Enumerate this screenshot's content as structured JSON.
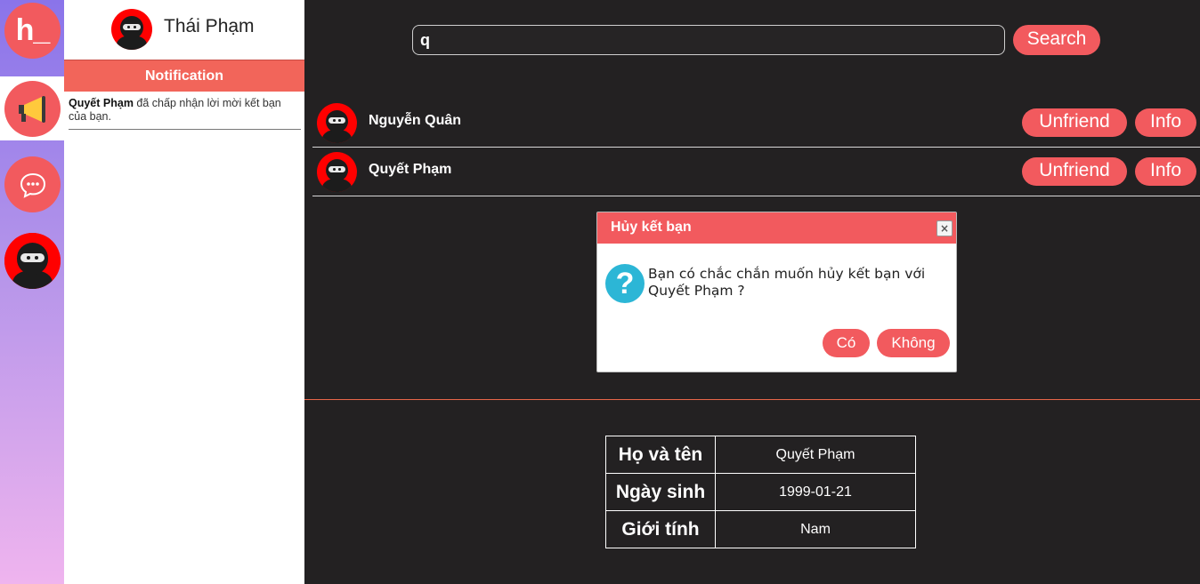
{
  "app": {
    "logo_text": "h_",
    "user_name": "Thái Phạm"
  },
  "rail": {
    "items": [
      {
        "icon": "logo-icon"
      },
      {
        "icon": "megaphone-icon"
      },
      {
        "icon": "chat-icon"
      },
      {
        "icon": "ninja-avatar-icon"
      }
    ]
  },
  "notification": {
    "title": "Notification",
    "items": [
      {
        "sender": "Quyết Phạm",
        "message": "đã chấp nhận lời mời kết bạn của bạn."
      }
    ]
  },
  "search": {
    "value": "q",
    "button_label": "Search"
  },
  "friends": [
    {
      "name": "Nguyễn Quân",
      "unfriend_label": "Unfriend",
      "info_label": "Info"
    },
    {
      "name": "Quyết Phạm",
      "unfriend_label": "Unfriend",
      "info_label": "Info"
    }
  ],
  "dialog": {
    "title": "Hủy kết bạn",
    "close_glyph": "×",
    "icon_glyph": "?",
    "message": "Bạn có chắc chắn muốn hủy kết bạn với Quyết Phạm ?",
    "yes_label": "Có",
    "no_label": "Không"
  },
  "profile": {
    "rows": [
      {
        "label": "Họ và tên",
        "value": "Quyết Phạm"
      },
      {
        "label": "Ngày sinh",
        "value": "1999-01-21"
      },
      {
        "label": "Giới tính",
        "value": "Nam"
      }
    ]
  },
  "colors": {
    "accent": "#f25a5e",
    "background": "#232122",
    "info_icon": "#2cb6d6"
  }
}
